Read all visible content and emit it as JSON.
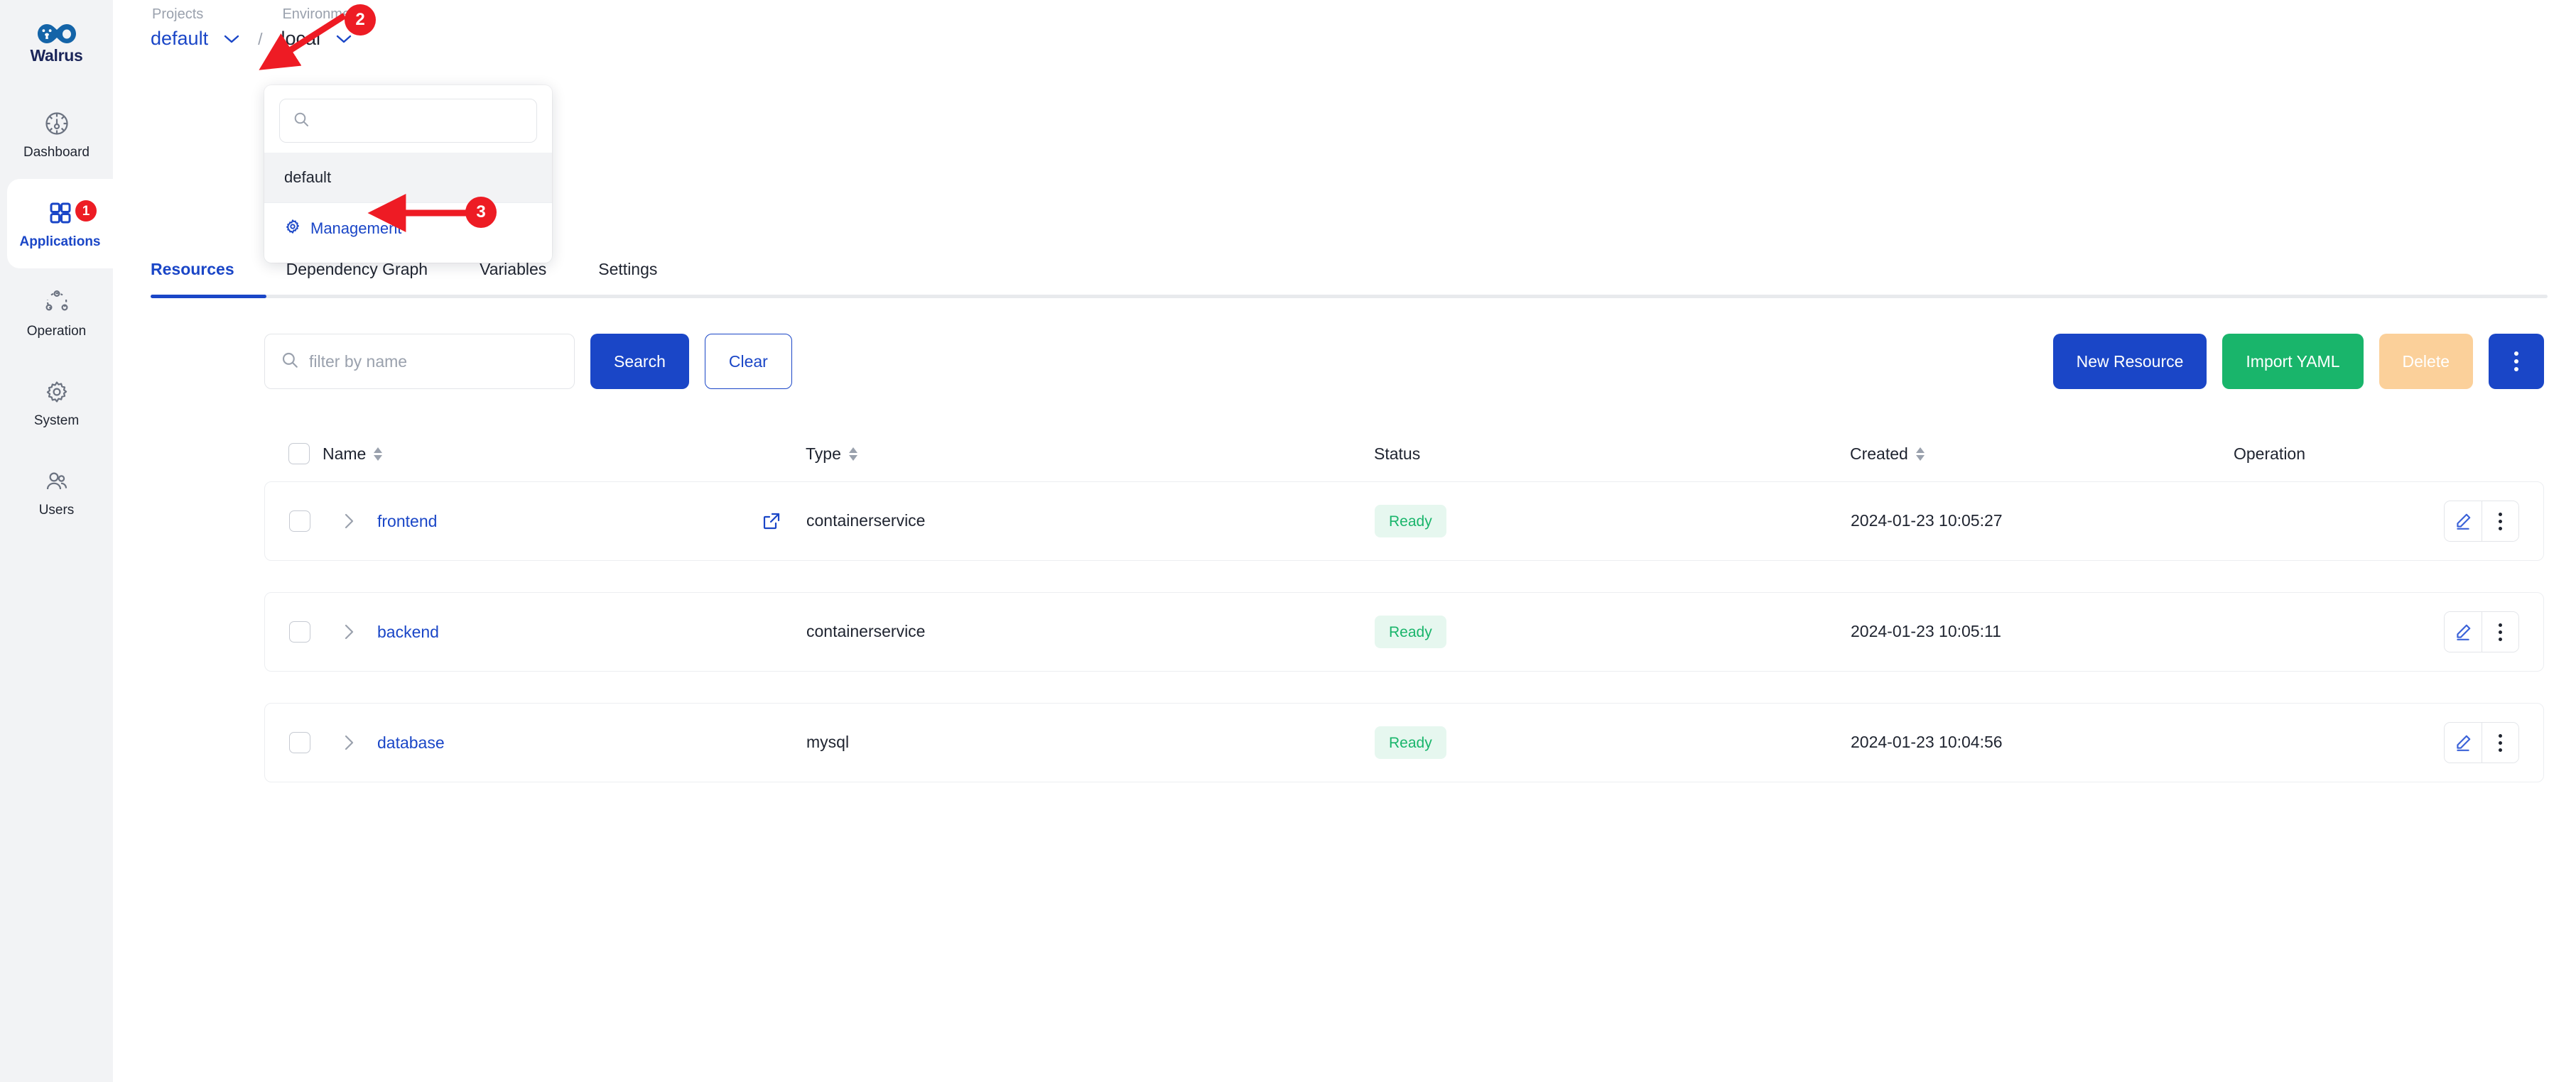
{
  "brand": {
    "name": "Walrus",
    "logo_icon": "walrus-infinity-logo"
  },
  "sidebar": {
    "items": [
      {
        "label": "Dashboard",
        "icon": "dashboard-gauge-icon",
        "active": false,
        "badge": null
      },
      {
        "label": "Applications",
        "icon": "apps-grid-icon",
        "active": true,
        "badge": "1"
      },
      {
        "label": "Operation",
        "icon": "operation-nodes-icon",
        "active": false,
        "badge": null
      },
      {
        "label": "System",
        "icon": "gear-icon",
        "active": false,
        "badge": null
      },
      {
        "label": "Users",
        "icon": "users-icon",
        "active": false,
        "badge": null
      }
    ]
  },
  "breadcrumb": {
    "project": {
      "caption": "Projects",
      "value": "default",
      "chevron_icon": "chevron-down-icon"
    },
    "separator": "/",
    "environment": {
      "caption": "Environments",
      "value": "local",
      "chevron_icon": "chevron-down-icon"
    }
  },
  "project_dropdown": {
    "open": true,
    "search": {
      "value": "",
      "placeholder": "",
      "icon": "search-icon"
    },
    "options": [
      {
        "label": "default",
        "selected": true
      }
    ],
    "management": {
      "label": "Management",
      "icon": "gear-icon"
    }
  },
  "tabs": [
    {
      "label": "Resources",
      "active": true
    },
    {
      "label": "Dependency Graph",
      "active": false
    },
    {
      "label": "Variables",
      "active": false
    },
    {
      "label": "Settings",
      "active": false
    }
  ],
  "toolbar": {
    "filter": {
      "value": "",
      "placeholder": "filter by name",
      "icon": "search-icon"
    },
    "search_label": "Search",
    "clear_label": "Clear",
    "new_resource_label": "New Resource",
    "import_yaml_label": "Import YAML",
    "delete_label": "Delete",
    "more_icon": "more-vertical-icon"
  },
  "table": {
    "select_all_checked": false,
    "columns": [
      {
        "key": "name",
        "label": "Name",
        "sortable": true
      },
      {
        "key": "type",
        "label": "Type",
        "sortable": true
      },
      {
        "key": "status",
        "label": "Status",
        "sortable": false
      },
      {
        "key": "created",
        "label": "Created",
        "sortable": true
      },
      {
        "key": "op",
        "label": "Operation",
        "sortable": false
      }
    ],
    "rows": [
      {
        "checked": false,
        "name": "frontend",
        "external_link": true,
        "type": "containerservice",
        "status": "Ready",
        "created": "2024-01-23 10:05:27",
        "edit_icon": "edit-pencil-icon",
        "more_icon": "more-vertical-icon"
      },
      {
        "checked": false,
        "name": "backend",
        "external_link": false,
        "type": "containerservice",
        "status": "Ready",
        "created": "2024-01-23 10:05:11",
        "edit_icon": "edit-pencil-icon",
        "more_icon": "more-vertical-icon"
      },
      {
        "checked": false,
        "name": "database",
        "external_link": false,
        "type": "mysql",
        "status": "Ready",
        "created": "2024-01-23 10:04:56",
        "edit_icon": "edit-pencil-icon",
        "more_icon": "more-vertical-icon"
      }
    ]
  },
  "annotations": [
    {
      "number": "1",
      "target": "applications-sidebar-item"
    },
    {
      "number": "2",
      "target": "project-dropdown-chevron"
    },
    {
      "number": "3",
      "target": "management-menu-item"
    }
  ],
  "colors": {
    "brand_blue": "#1a46c7",
    "green": "#19b56b",
    "green_soft": "#e6f7ef",
    "orange_disabled": "#fbd09a",
    "annotation_red": "#ed1c24",
    "sidebar_bg": "#f2f3f5",
    "muted_text": "#9aa1ad"
  }
}
